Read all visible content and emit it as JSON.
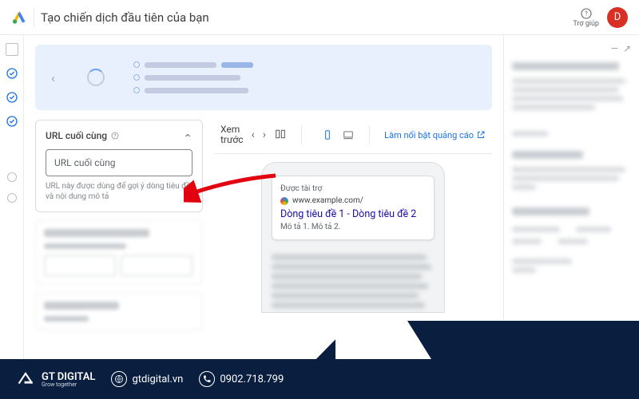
{
  "header": {
    "title": "Tạo chiến dịch đầu tiên của bạn",
    "help_label": "Trợ giúp",
    "avatar_initial": "D"
  },
  "url_card": {
    "title": "URL cuối cùng",
    "input_placeholder": "URL cuối cùng",
    "hint": "URL này được dùng để gợi ý dòng tiêu đề và nội dung mô tả"
  },
  "preview_bar": {
    "label_line1": "Xem",
    "label_line2": "trước",
    "highlight_link": "Làm nổi bật quảng cáo"
  },
  "ad_preview": {
    "sponsored_label": "Được tài trợ",
    "display_url": "www.example.com/",
    "headline": "Dòng tiêu đề 1 - Dòng tiêu đề 2",
    "description": "Mô tả 1. Mô tả 2."
  },
  "footer": {
    "brand_name": "GT DIGITAL",
    "brand_tag": "Grow together",
    "website": "gtdigital.vn",
    "phone": "0902.718.799"
  }
}
